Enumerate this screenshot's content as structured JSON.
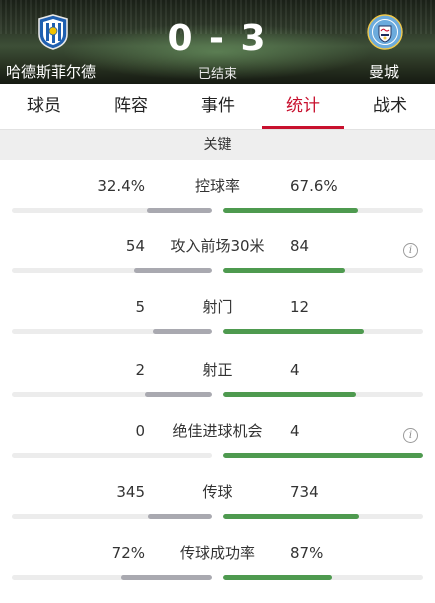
{
  "match": {
    "home_team": "哈德斯菲尔德",
    "away_team": "曼城",
    "score": "0 - 3",
    "status": "已结束",
    "home_crest_icon": "huddersfield-crest-icon",
    "away_crest_icon": "manchester-city-crest-icon"
  },
  "tabs": [
    {
      "label": "球员",
      "active": false
    },
    {
      "label": "阵容",
      "active": false
    },
    {
      "label": "事件",
      "active": false
    },
    {
      "label": "统计",
      "active": true
    },
    {
      "label": "战术",
      "active": false
    }
  ],
  "section": {
    "title": "关键"
  },
  "colors": {
    "accent": "#c8102e",
    "home_bar": "#a9a9b0",
    "away_bar": "#4e9a4f",
    "track": "#ececec"
  },
  "stats": [
    {
      "label": "控球率",
      "home": "32.4%",
      "away": "67.6%",
      "home_frac": 0.324,
      "away_frac": 0.676,
      "info": false
    },
    {
      "label": "攻入前场30米",
      "home": "54",
      "away": "84",
      "home_frac": 0.391,
      "away_frac": 0.609,
      "info": true
    },
    {
      "label": "射门",
      "home": "5",
      "away": "12",
      "home_frac": 0.294,
      "away_frac": 0.706,
      "info": false
    },
    {
      "label": "射正",
      "home": "2",
      "away": "4",
      "home_frac": 0.333,
      "away_frac": 0.667,
      "info": false
    },
    {
      "label": "绝佳进球机会",
      "home": "0",
      "away": "4",
      "home_frac": 0.0,
      "away_frac": 1.0,
      "info": true
    },
    {
      "label": "传球",
      "home": "345",
      "away": "734",
      "home_frac": 0.32,
      "away_frac": 0.68,
      "info": false
    },
    {
      "label": "传球成功率",
      "home": "72%",
      "away": "87%",
      "home_frac": 0.453,
      "away_frac": 0.547,
      "info": false
    }
  ]
}
